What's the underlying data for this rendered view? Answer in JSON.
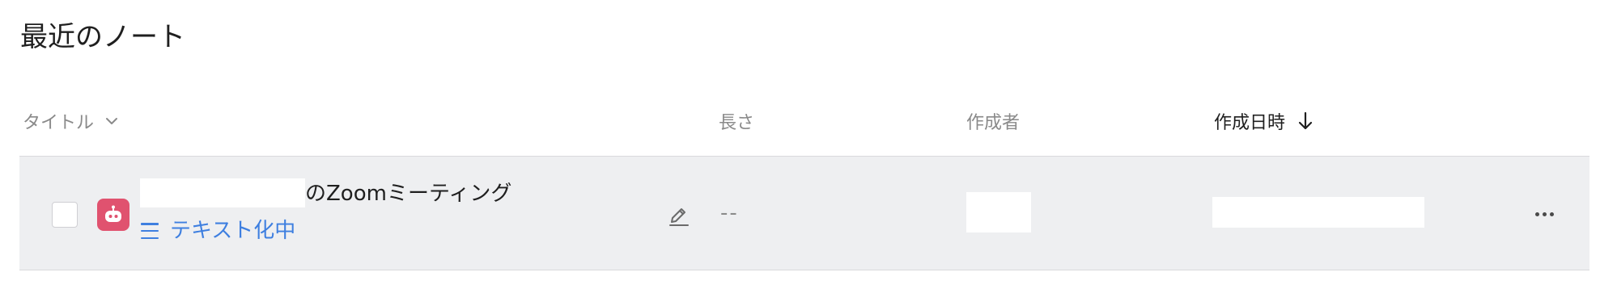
{
  "page": {
    "title": "最近のノート"
  },
  "columns": {
    "title": "タイトル",
    "length": "長さ",
    "author": "作成者",
    "created": "作成日時"
  },
  "rows": [
    {
      "name_suffix": "のZoomミーティング",
      "status": "テキスト化中",
      "length": "--"
    }
  ],
  "colors": {
    "accent": "#3e7fe0",
    "app_icon_bg": "#e0526f",
    "row_bg": "#eeeff1"
  },
  "icons": {
    "title_sort": "chevron-down-icon",
    "created_sort": "arrow-down-icon",
    "app": "bot-icon",
    "status": "lines-icon",
    "edit": "pencil-icon",
    "more": "more-horizontal-icon"
  }
}
